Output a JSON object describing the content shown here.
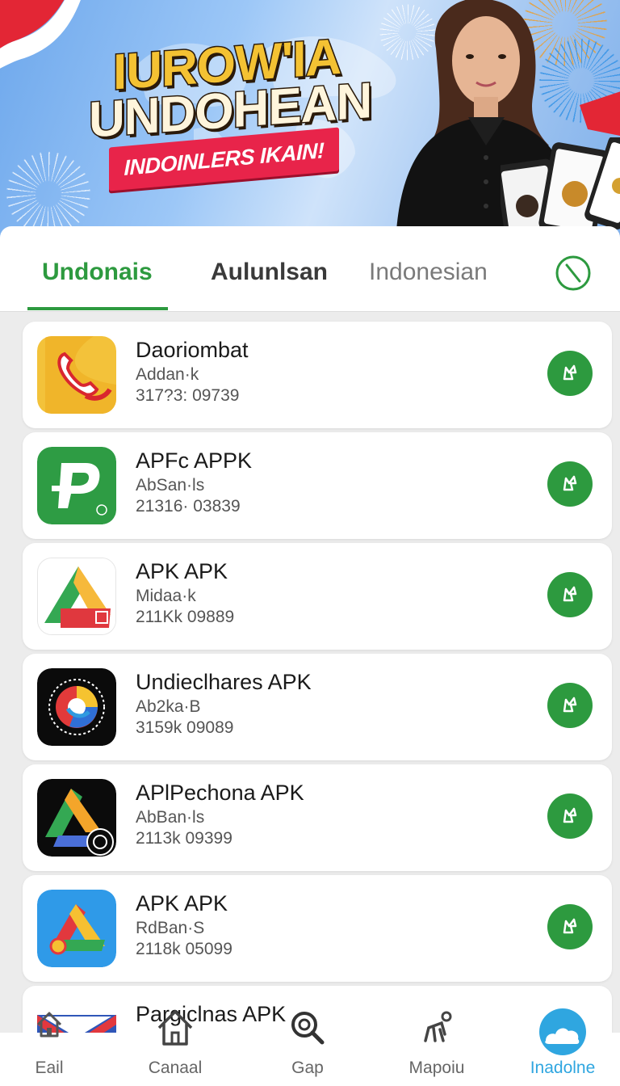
{
  "banner": {
    "headline_line1": "IUROW'IA",
    "headline_line2": "UNDOHEAN",
    "ribbon_text": "INDOINLERS IKAIN!"
  },
  "tabs": [
    {
      "label": "Undonais",
      "active": true
    },
    {
      "label": "Aulunlsan",
      "active": false
    },
    {
      "label": "Indonesian",
      "active": false
    }
  ],
  "apps": [
    {
      "name": "Daoriombat",
      "subtitle": "Addan·k",
      "meta": "317?3: 09739",
      "icon": "phone-app-icon"
    },
    {
      "name": "APFc APPK",
      "subtitle": "AbSan·ls",
      "meta": "21316· 03839",
      "icon": "p-app-icon"
    },
    {
      "name": "APK APK",
      "subtitle": "Midaa·k",
      "meta": "211Kk 09889",
      "icon": "triangle-app-icon"
    },
    {
      "name": "Undieclhares APK",
      "subtitle": "Ab2ka·B",
      "meta": "3159k 09089",
      "icon": "browser-app-icon"
    },
    {
      "name": "APlPechona APK",
      "subtitle": "AbBan·ls",
      "meta": "2113k 09399",
      "icon": "drive-dark-app-icon"
    },
    {
      "name": "APK APK",
      "subtitle": "RdBan·S",
      "meta": "2118k 05099",
      "icon": "drive-blue-app-icon"
    },
    {
      "name": "Pargiclnas APK",
      "subtitle": "",
      "meta": "",
      "icon": "mail-app-icon"
    }
  ],
  "nav": [
    {
      "label": "Eail",
      "icon": "home-icon"
    },
    {
      "label": "Canaal",
      "icon": "house-outline-icon"
    },
    {
      "label": "Gap",
      "icon": "search-icon"
    },
    {
      "label": "Mapoiu",
      "icon": "figure-icon"
    },
    {
      "label": "Inadolne",
      "icon": "cloud-icon",
      "active": true
    }
  ],
  "colors": {
    "accent_green": "#2d9a3f",
    "nav_active": "#2fa6e0",
    "ribbon_red": "#e8244a",
    "headline_gold": "#f4c233"
  }
}
